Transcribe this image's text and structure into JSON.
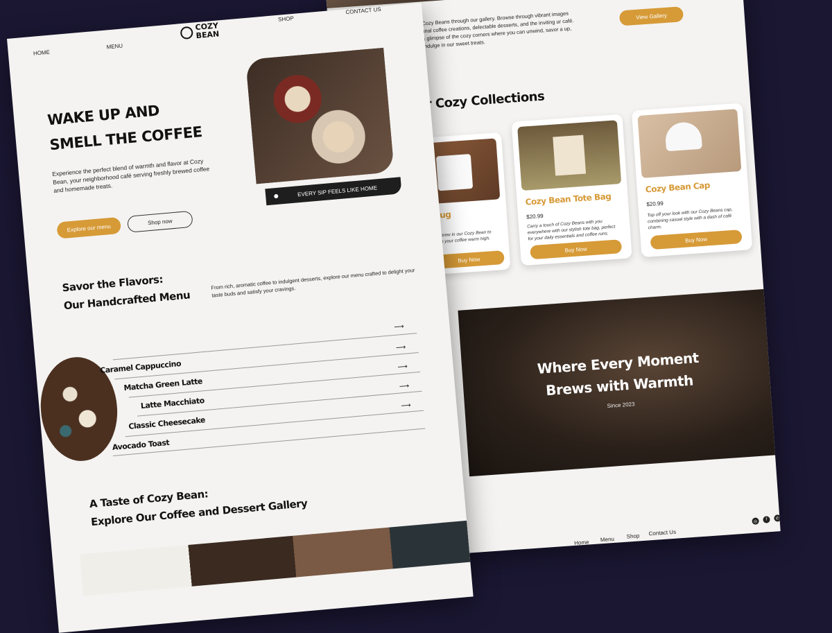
{
  "gallery_page": {
    "intro_text": "rt of Cozy Beans through our gallery. Browse through vibrant images artisanal coffee creations, delectable desserts, and the inviting ur café. Get a glimpse of the cozy corners where you can unwind, savor a up, and indulge in our sweet treats.",
    "view_gallery_label": "View Gallery",
    "collections_title": "ur Cozy Collections",
    "products": [
      {
        "name": "Mug",
        "price": "",
        "desc": "rite brew in our Cozy Bean to keep your coffee warm high.",
        "button": "Buy Now"
      },
      {
        "name": "Cozy Bean Tote Bag",
        "price": "$20.99",
        "desc": "Carry a touch of Cozy Beans with you everywhere with our stylish tote bag, perfect for your daily essentials and coffee runs.",
        "button": "Buy Now"
      },
      {
        "name": "Cozy Bean Cap",
        "price": "$20.99",
        "desc": "Top off your look with our Cozy Beans cap, combining casual style with a dash of café charm.",
        "button": "Buy Now"
      }
    ],
    "band": {
      "title_line1": "Where Every Moment",
      "title_line2": "Brews with Warmth",
      "since": "Since 2023"
    },
    "footer_nav": [
      "Home",
      "Menu",
      "Shop",
      "Contact Us"
    ],
    "social_icons": [
      "instagram-icon",
      "facebook-icon",
      "whatsapp-icon"
    ]
  },
  "home_page": {
    "nav": {
      "home": "HOME",
      "menu": "MENU",
      "shop": "SHOP",
      "contact": "CONTACT US"
    },
    "logo": {
      "line1": "COZY",
      "line2": "BEAN"
    },
    "hero": {
      "title_line1": "WAKE UP AND",
      "title_line2": "SMELL THE COFFEE",
      "text": "Experience the perfect blend of warmth and flavor at Cozy Bean, your neighborhood café serving freshly brewed coffee and homemade treats.",
      "explore_label": "Explore our menu",
      "shop_label": "Shop now",
      "caption": "EVERY SIP FEELS LIKE HOME"
    },
    "menu_section": {
      "title_line1": "Savor the Flavors:",
      "title_line2": "Our Handcrafted Menu",
      "text": "From rich, aromatic coffee to indulgent desserts, explore our menu crafted to delight your taste buds and satisfy your cravings.",
      "items": [
        "Caramel Cappuccino",
        "Matcha Green Latte",
        "Latte Macchiato",
        "Classic Cheesecake",
        "Avocado Toast"
      ]
    },
    "gallery_section": {
      "title_line1": "A Taste of Cozy Bean:",
      "title_line2": "Explore Our Coffee and Dessert Gallery"
    }
  },
  "colors": {
    "background": "#1b1733",
    "page": "#f4f3f1",
    "accent": "#d69a37",
    "text": "#111111"
  }
}
